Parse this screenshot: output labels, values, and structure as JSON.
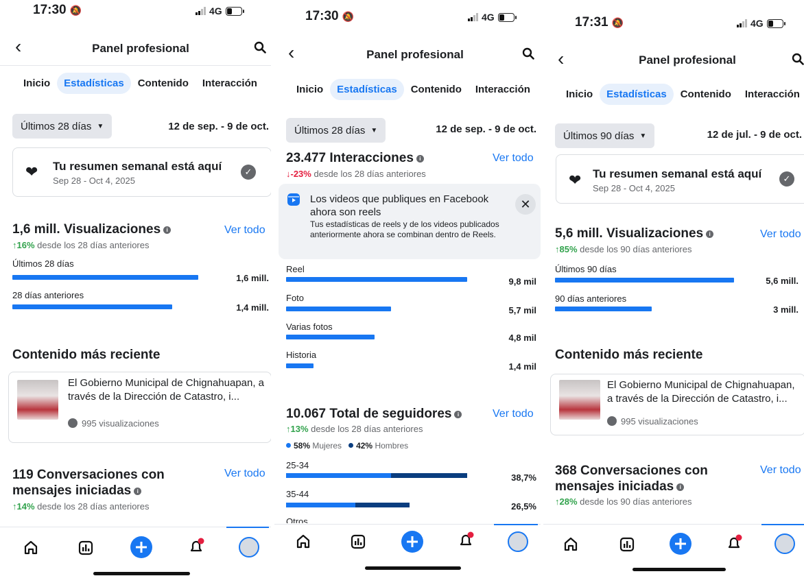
{
  "common": {
    "header_title": "Panel profesional",
    "tabs": [
      "Inicio",
      "Estadísticas",
      "Contenido",
      "Interacción"
    ],
    "signal_label": "4G",
    "ver_todo": "Ver todo",
    "recent_title": "Contenido más reciente",
    "recent_post_text": "El Gobierno Municipal de Chignahuapan, a través de la Dirección de Catastro, i...",
    "recent_post_views": "995 visualizaciones",
    "weekly_title": "Tu resumen semanal está aquí",
    "weekly_dates": "Sep 28 - Oct 4, 2025",
    "colors": {
      "accent": "#1877f2",
      "up": "#31a24c",
      "down": "#e41e3f",
      "dark_blue": "#0a3d7f"
    },
    "icons": [
      "back-icon",
      "search-icon",
      "home-icon",
      "chart-icon",
      "plus-icon",
      "bell-icon",
      "profile-icon",
      "heart-icon",
      "check-icon",
      "reels-icon",
      "close-icon"
    ]
  },
  "screen1": {
    "time": "17:30",
    "period": "Últimos 28 días",
    "range": "12 de sep. - 9 de oct.",
    "views": {
      "title": "1,6 mill. Visualizaciones",
      "delta": "↑16%",
      "delta_text": "desde los 28 días anteriores",
      "rows": [
        {
          "label": "Últimos 28 días",
          "value": "1,6 mill.",
          "fraction": 1.0
        },
        {
          "label": "28 días anteriores",
          "value": "1,4 mill.",
          "fraction": 0.86
        }
      ]
    },
    "conversations": {
      "title_line1": "119 Conversaciones con",
      "title_line2": "mensajes iniciadas",
      "delta": "↑14%",
      "delta_text": "desde los 28 días anteriores"
    }
  },
  "screen2": {
    "time": "17:30",
    "period": "Últimos 28 días",
    "range": "12 de sep. - 9 de oct.",
    "interactions": {
      "title": "23.477 Interacciones",
      "delta": "↓-23%",
      "delta_text": "desde los 28 días anteriores"
    },
    "notice": {
      "title": "Los videos que publiques en Facebook ahora son reels",
      "body": "Tus estadísticas de reels y de los videos publicados anteriormente ahora se combinan dentro de Reels."
    },
    "breakdown": [
      {
        "label": "Reel",
        "value": "9,8 mil",
        "fraction": 1.0
      },
      {
        "label": "Foto",
        "value": "5,7 mil",
        "fraction": 0.58
      },
      {
        "label": "Varias fotos",
        "value": "4,8 mil",
        "fraction": 0.49
      },
      {
        "label": "Historia",
        "value": "1,4 mil",
        "fraction": 0.15
      }
    ],
    "followers": {
      "title": "10.067 Total de seguidores",
      "delta": "↑13%",
      "delta_text": "desde los 28 días anteriores",
      "women_pct": "58%",
      "women_label": "Mujeres",
      "men_pct": "42%",
      "men_label": "Hombres",
      "age_rows": [
        {
          "label": "25-34",
          "value": "38,7%",
          "fraction": 1.0,
          "women_share": 0.58
        },
        {
          "label": "35-44",
          "value": "26,5%",
          "fraction": 0.68,
          "women_share": 0.56
        }
      ],
      "cut_label": "Otros"
    }
  },
  "screen3": {
    "time": "17:31",
    "period": "Últimos 90 días",
    "range": "12 de jul. - 9 de oct.",
    "views": {
      "title": "5,6 mill. Visualizaciones",
      "delta": "↑85%",
      "delta_text": "desde los 90 días anteriores",
      "rows": [
        {
          "label": "Últimos 90 días",
          "value": "5,6 mill.",
          "fraction": 1.0
        },
        {
          "label": "90 días anteriores",
          "value": "3 mill.",
          "fraction": 0.54
        }
      ]
    },
    "conversations": {
      "title_line1": "368 Conversaciones con",
      "title_line2": "mensajes iniciadas",
      "delta": "↑28%",
      "delta_text": "desde los 90 días anteriores"
    }
  }
}
